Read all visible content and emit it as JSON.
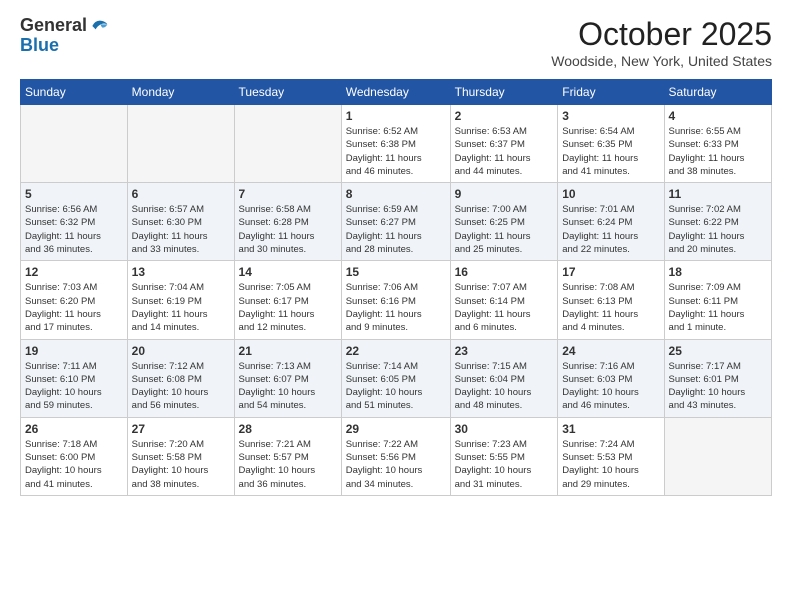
{
  "header": {
    "logo_general": "General",
    "logo_blue": "Blue",
    "month_title": "October 2025",
    "location": "Woodside, New York, United States"
  },
  "weekdays": [
    "Sunday",
    "Monday",
    "Tuesday",
    "Wednesday",
    "Thursday",
    "Friday",
    "Saturday"
  ],
  "weeks": [
    [
      {
        "num": "",
        "info": ""
      },
      {
        "num": "",
        "info": ""
      },
      {
        "num": "",
        "info": ""
      },
      {
        "num": "1",
        "info": "Sunrise: 6:52 AM\nSunset: 6:38 PM\nDaylight: 11 hours\nand 46 minutes."
      },
      {
        "num": "2",
        "info": "Sunrise: 6:53 AM\nSunset: 6:37 PM\nDaylight: 11 hours\nand 44 minutes."
      },
      {
        "num": "3",
        "info": "Sunrise: 6:54 AM\nSunset: 6:35 PM\nDaylight: 11 hours\nand 41 minutes."
      },
      {
        "num": "4",
        "info": "Sunrise: 6:55 AM\nSunset: 6:33 PM\nDaylight: 11 hours\nand 38 minutes."
      }
    ],
    [
      {
        "num": "5",
        "info": "Sunrise: 6:56 AM\nSunset: 6:32 PM\nDaylight: 11 hours\nand 36 minutes."
      },
      {
        "num": "6",
        "info": "Sunrise: 6:57 AM\nSunset: 6:30 PM\nDaylight: 11 hours\nand 33 minutes."
      },
      {
        "num": "7",
        "info": "Sunrise: 6:58 AM\nSunset: 6:28 PM\nDaylight: 11 hours\nand 30 minutes."
      },
      {
        "num": "8",
        "info": "Sunrise: 6:59 AM\nSunset: 6:27 PM\nDaylight: 11 hours\nand 28 minutes."
      },
      {
        "num": "9",
        "info": "Sunrise: 7:00 AM\nSunset: 6:25 PM\nDaylight: 11 hours\nand 25 minutes."
      },
      {
        "num": "10",
        "info": "Sunrise: 7:01 AM\nSunset: 6:24 PM\nDaylight: 11 hours\nand 22 minutes."
      },
      {
        "num": "11",
        "info": "Sunrise: 7:02 AM\nSunset: 6:22 PM\nDaylight: 11 hours\nand 20 minutes."
      }
    ],
    [
      {
        "num": "12",
        "info": "Sunrise: 7:03 AM\nSunset: 6:20 PM\nDaylight: 11 hours\nand 17 minutes."
      },
      {
        "num": "13",
        "info": "Sunrise: 7:04 AM\nSunset: 6:19 PM\nDaylight: 11 hours\nand 14 minutes."
      },
      {
        "num": "14",
        "info": "Sunrise: 7:05 AM\nSunset: 6:17 PM\nDaylight: 11 hours\nand 12 minutes."
      },
      {
        "num": "15",
        "info": "Sunrise: 7:06 AM\nSunset: 6:16 PM\nDaylight: 11 hours\nand 9 minutes."
      },
      {
        "num": "16",
        "info": "Sunrise: 7:07 AM\nSunset: 6:14 PM\nDaylight: 11 hours\nand 6 minutes."
      },
      {
        "num": "17",
        "info": "Sunrise: 7:08 AM\nSunset: 6:13 PM\nDaylight: 11 hours\nand 4 minutes."
      },
      {
        "num": "18",
        "info": "Sunrise: 7:09 AM\nSunset: 6:11 PM\nDaylight: 11 hours\nand 1 minute."
      }
    ],
    [
      {
        "num": "19",
        "info": "Sunrise: 7:11 AM\nSunset: 6:10 PM\nDaylight: 10 hours\nand 59 minutes."
      },
      {
        "num": "20",
        "info": "Sunrise: 7:12 AM\nSunset: 6:08 PM\nDaylight: 10 hours\nand 56 minutes."
      },
      {
        "num": "21",
        "info": "Sunrise: 7:13 AM\nSunset: 6:07 PM\nDaylight: 10 hours\nand 54 minutes."
      },
      {
        "num": "22",
        "info": "Sunrise: 7:14 AM\nSunset: 6:05 PM\nDaylight: 10 hours\nand 51 minutes."
      },
      {
        "num": "23",
        "info": "Sunrise: 7:15 AM\nSunset: 6:04 PM\nDaylight: 10 hours\nand 48 minutes."
      },
      {
        "num": "24",
        "info": "Sunrise: 7:16 AM\nSunset: 6:03 PM\nDaylight: 10 hours\nand 46 minutes."
      },
      {
        "num": "25",
        "info": "Sunrise: 7:17 AM\nSunset: 6:01 PM\nDaylight: 10 hours\nand 43 minutes."
      }
    ],
    [
      {
        "num": "26",
        "info": "Sunrise: 7:18 AM\nSunset: 6:00 PM\nDaylight: 10 hours\nand 41 minutes."
      },
      {
        "num": "27",
        "info": "Sunrise: 7:20 AM\nSunset: 5:58 PM\nDaylight: 10 hours\nand 38 minutes."
      },
      {
        "num": "28",
        "info": "Sunrise: 7:21 AM\nSunset: 5:57 PM\nDaylight: 10 hours\nand 36 minutes."
      },
      {
        "num": "29",
        "info": "Sunrise: 7:22 AM\nSunset: 5:56 PM\nDaylight: 10 hours\nand 34 minutes."
      },
      {
        "num": "30",
        "info": "Sunrise: 7:23 AM\nSunset: 5:55 PM\nDaylight: 10 hours\nand 31 minutes."
      },
      {
        "num": "31",
        "info": "Sunrise: 7:24 AM\nSunset: 5:53 PM\nDaylight: 10 hours\nand 29 minutes."
      },
      {
        "num": "",
        "info": ""
      }
    ]
  ]
}
